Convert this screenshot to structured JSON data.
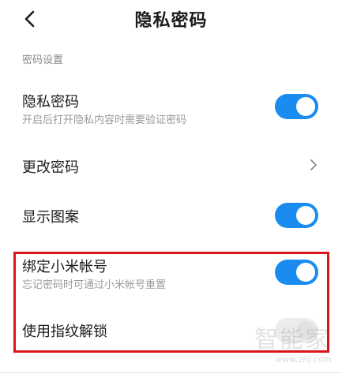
{
  "header": {
    "title": "隐私密码",
    "back_icon": "back-arrow-icon"
  },
  "section": {
    "label": "密码设置"
  },
  "settings": {
    "privacy_password": {
      "title": "隐私密码",
      "subtitle": "开启后打开隐私内容时需要验证密码",
      "enabled": true
    },
    "change_password": {
      "title": "更改密码",
      "icon": "chevron-right-icon"
    },
    "show_pattern": {
      "title": "显示图案",
      "enabled": true
    },
    "bind_mi_account": {
      "title": "绑定小米帐号",
      "subtitle": "忘记密码时可通过小米帐号重置",
      "enabled": true
    },
    "fingerprint_unlock": {
      "title": "使用指纹解锁",
      "enabled": false
    }
  },
  "watermark": {
    "text": "智能家",
    "url": "www.znj.com"
  },
  "colors": {
    "toggle_on": "#1a8cf0",
    "highlight_border": "#d9151a"
  }
}
